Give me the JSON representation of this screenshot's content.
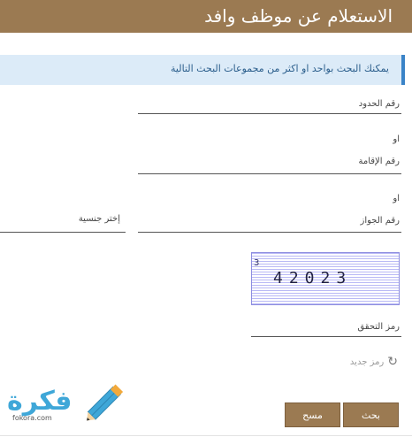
{
  "header": {
    "title": "الاستعلام عن موظف وافد"
  },
  "info": {
    "text": "يمكنك البحث بواحد او اكثر من مجموعات البحث التالية"
  },
  "fields": {
    "border_number": "رقم الحدود",
    "iqama_number": "رقم الإقامة",
    "passport_number": "رقم الجواز",
    "nationality": "إختر جنسية",
    "verification_code": "رمز التحقق"
  },
  "or_labels": [
    "او",
    "او"
  ],
  "captcha": {
    "code": "42023",
    "tiny": "3"
  },
  "refresh": {
    "label": "رمز جديد"
  },
  "buttons": {
    "search": "بحث",
    "clear": "مسح"
  },
  "logo": {
    "word": "فكرة",
    "sub": "fokora.com"
  },
  "colors": {
    "header": "#9b7a52",
    "info_bg": "#dcebf8",
    "info_accent": "#3a83c7",
    "logo": "#3fa7d8"
  }
}
